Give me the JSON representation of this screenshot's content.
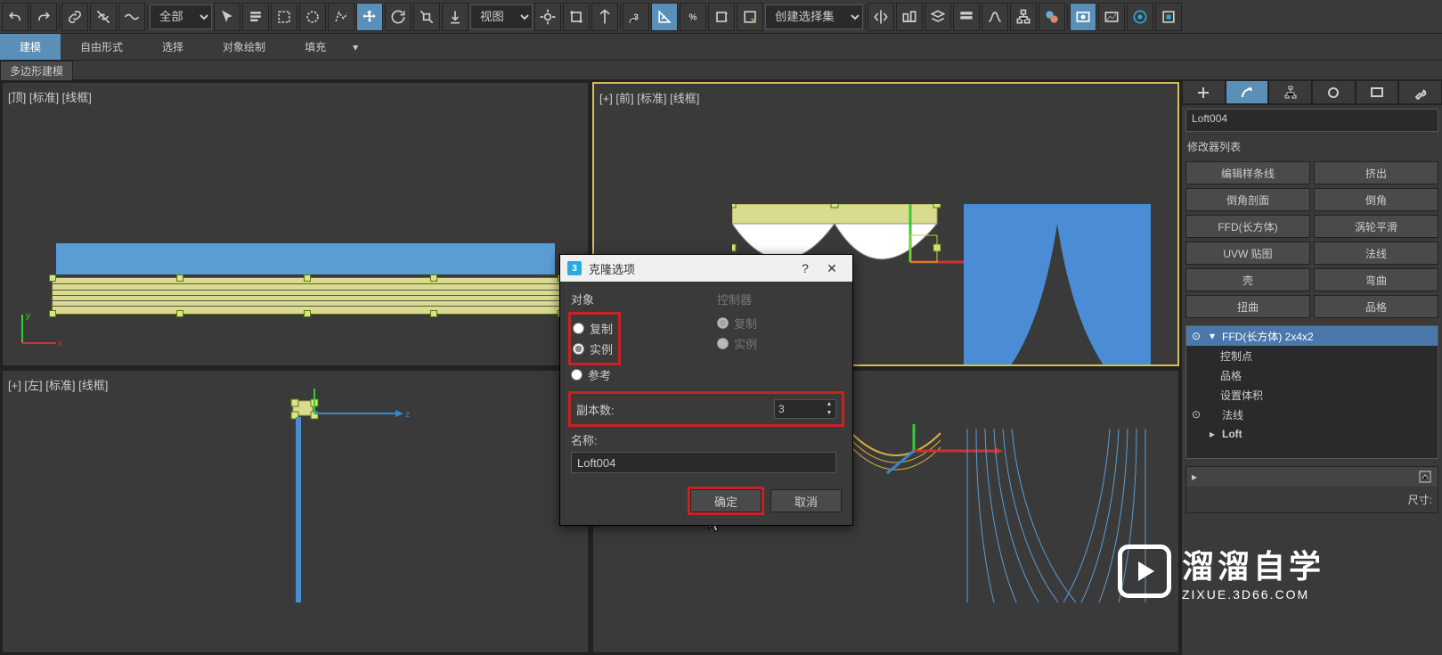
{
  "toolbar": {
    "selection_filter": "全部",
    "ref_coord": "视图",
    "named_sel": "创建选择集"
  },
  "menubar": {
    "items": [
      "建模",
      "自由形式",
      "选择",
      "对象绘制",
      "填充"
    ]
  },
  "subtab": {
    "label": "多边形建模"
  },
  "viewports": {
    "top": "[顶] [标准] [线框]",
    "front": "[+] [前] [标准] [线框]",
    "left": "[+] [左] [标准] [线框]"
  },
  "right": {
    "obj_name": "Loft004",
    "modlist_label": "修改器列表",
    "buttons": [
      "编辑样条线",
      "挤出",
      "倒角剖面",
      "倒角",
      "FFD(长方体)",
      "涡轮平滑",
      "UVW 贴图",
      "法线",
      "壳",
      "弯曲",
      "扭曲",
      "品格"
    ],
    "stack": {
      "item_ffd": "FFD(长方体) 2x4x2",
      "sub_ctrl": "控制点",
      "sub_lattice": "品格",
      "sub_vol": "设置体积",
      "item_normal": "法线",
      "item_loft": "Loft"
    },
    "rollout_dim_label": "尺寸:"
  },
  "dialog": {
    "title": "克隆选项",
    "group_obj": "对象",
    "group_ctrl": "控制器",
    "opt_copy": "复制",
    "opt_instance": "实例",
    "opt_ref": "参考",
    "copies_label": "副本数:",
    "copies_value": "3",
    "name_label": "名称:",
    "name_value": "Loft004",
    "ok": "确定",
    "cancel": "取消"
  },
  "watermark": {
    "title": "溜溜自学",
    "sub": "ZIXUE.3D66.COM"
  },
  "icons": {
    "undo": "undo",
    "redo": "redo",
    "link": "link",
    "unlink": "unlink",
    "bind": "bind",
    "select": "select",
    "name": "name",
    "rect": "rect",
    "circle": "circle",
    "fence": "fence",
    "lasso": "lasso",
    "paint": "paint",
    "window": "window",
    "move": "move",
    "rotate": "rotate",
    "scale": "scale",
    "place": "place",
    "snaptog": "snaptog",
    "angle": "angle",
    "percent": "percent",
    "spinner": "spinner",
    "mirror": "mirror",
    "align": "align",
    "layers": "layers",
    "curve": "curve",
    "schem": "schem",
    "matl": "matl",
    "render": "render"
  }
}
